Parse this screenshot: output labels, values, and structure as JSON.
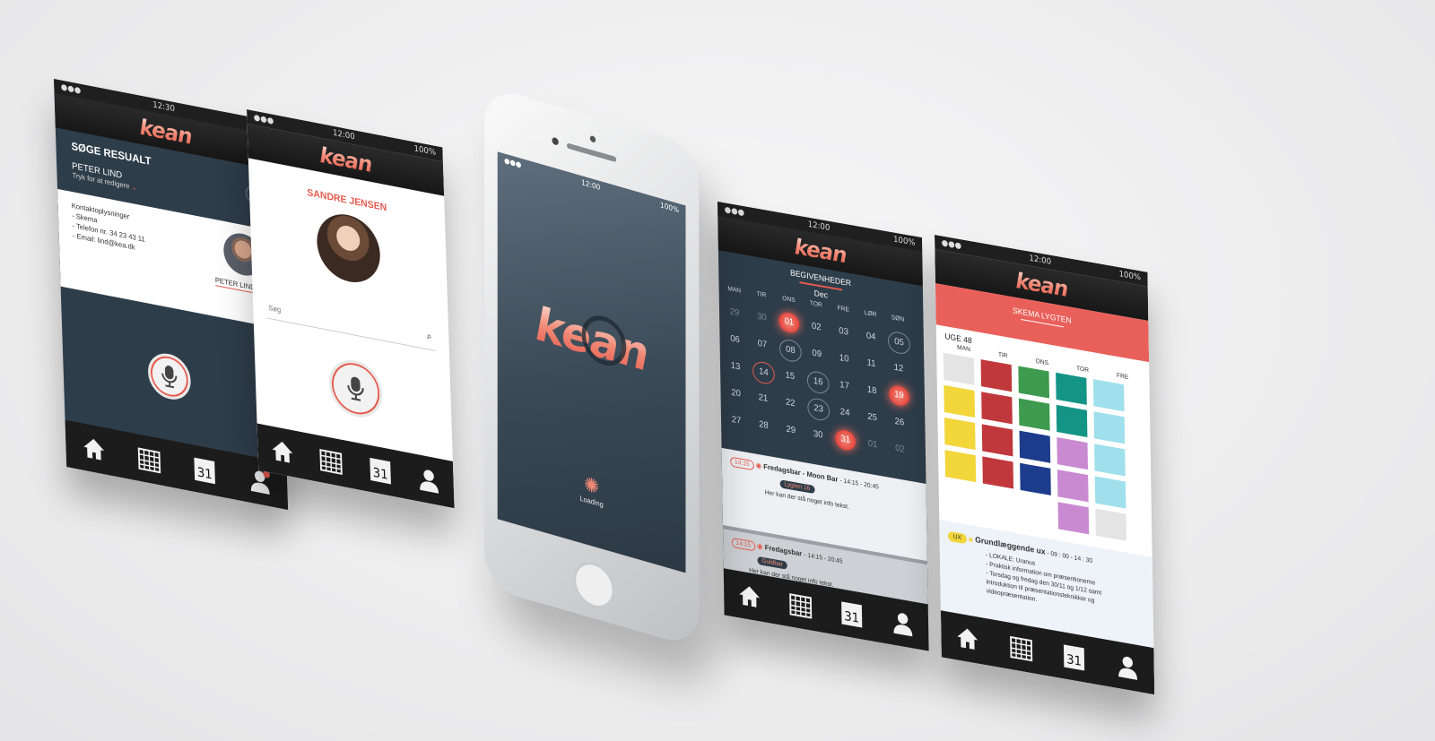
{
  "status": {
    "time_a": "12:30",
    "time_b": "12:00",
    "battery": "100%"
  },
  "brand": {
    "logo": "kean"
  },
  "screen1": {
    "title": "SØGE RESUALT",
    "name": "PETER LIND",
    "edit_hint": "Tryk for at redigere",
    "info_heading": "Kontaktoplysninger",
    "info_lines": [
      "- Skema",
      "- Telefon nr. 34 23 43 11",
      "- Email: lind@kea.dk"
    ],
    "avatar_label": "PETER LIND",
    "add_badge": "+"
  },
  "screen2": {
    "name": "SANDRE JENSEN",
    "search_placeholder": "Søg"
  },
  "phone": {
    "time": "12:00",
    "battery": "100%",
    "loading": "Loading"
  },
  "screen4": {
    "section": "BEGIVENHEDER",
    "month": "Dec",
    "weekdays": [
      "MAN",
      "TIR",
      "ONS",
      "TOR",
      "FRE",
      "LØR",
      "SØN"
    ],
    "days": [
      "29",
      "30",
      "01",
      "02",
      "03",
      "04",
      "05",
      "06",
      "07",
      "08",
      "09",
      "10",
      "11",
      "12",
      "13",
      "14",
      "15",
      "16",
      "17",
      "18",
      "19",
      "20",
      "21",
      "22",
      "23",
      "24",
      "25",
      "26",
      "27",
      "28",
      "29",
      "30",
      "31",
      "01",
      "02"
    ],
    "events": [
      {
        "time": "14:15",
        "title": "Fredagsbar - Moon Bar",
        "hours": "- 14:15 - 20:45",
        "tag": "Lygten 16",
        "desc": "Her kan der stå noget info tekst."
      },
      {
        "time": "14:15",
        "title": "Fredagsbar",
        "hours": "- 14:15 - 20:45",
        "tag": "Guldbar",
        "desc": "Her kan der stå noget info tekst."
      }
    ]
  },
  "screen5": {
    "section": "SKEMA LYGTEN",
    "week": "UGE 48",
    "weekdays": [
      "MAN",
      "TIR",
      "ONS",
      "TOR",
      "FRE"
    ],
    "tag": "UX",
    "course_title": "Grundlæggende ux",
    "course_time": "- 09 : 00 - 14 : 30",
    "course_lines": [
      "- LOKALE: Uranus",
      "- Praktisk information om præsentionerne",
      "- Torsdag og fredag den 30/11 og 1/12 samt",
      "introduktion til præsentationsteknikker og",
      "videopræsentation."
    ]
  },
  "tabbar": {
    "calendar_day": "31"
  },
  "colors": {
    "accent": "#e65a4d",
    "dark": "#1c1c1c",
    "panel": "#2e3d4a",
    "header_red": "#e9605a"
  }
}
